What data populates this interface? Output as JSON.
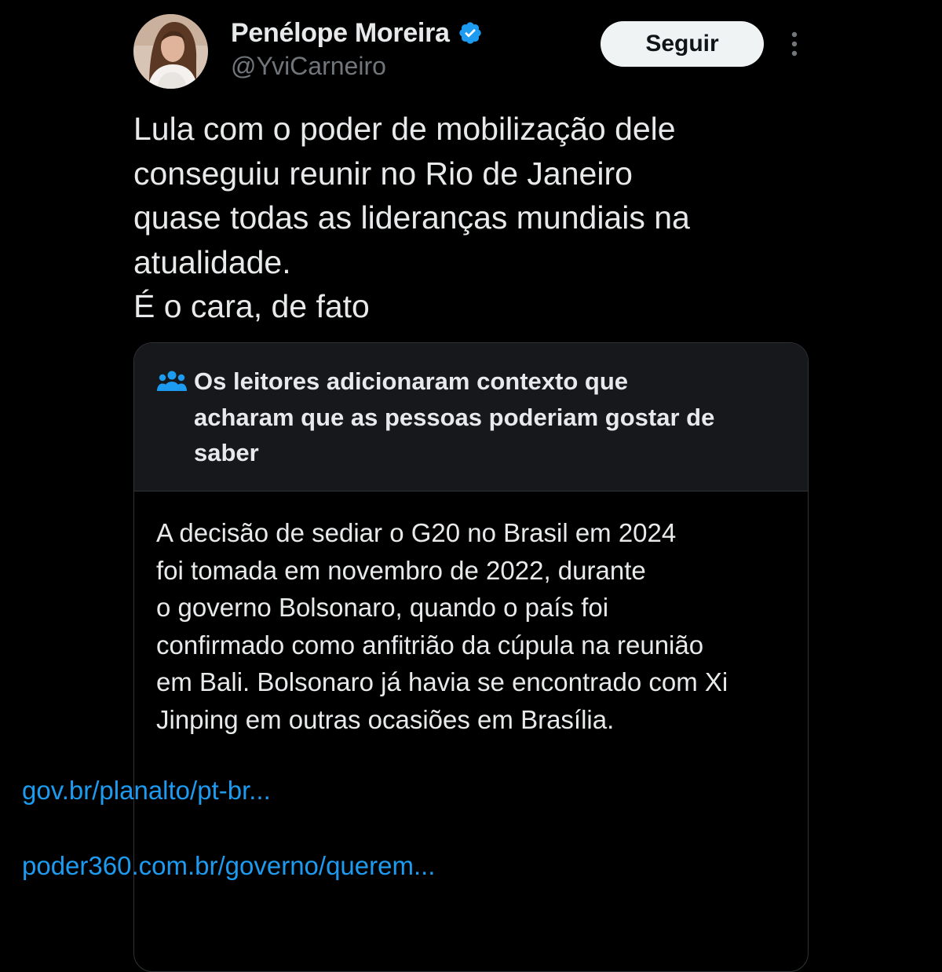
{
  "author": {
    "display_name": "Penélope Moreira",
    "handle": "@YviCarneiro",
    "verified": true
  },
  "actions": {
    "follow_label": "Seguir",
    "more_icon": "more-vertical-icon"
  },
  "tweet": {
    "lines": [
      "Lula com o poder de mobilização dele",
      "conseguiu reunir no Rio de Janeiro",
      "quase todas as lideranças mundiais na",
      "atualidade.",
      "É o cara, de fato"
    ]
  },
  "community_note": {
    "icon": "people-icon",
    "title_lines": [
      "Os leitores adicionaram contexto que",
      "acharam que as pessoas poderiam gostar de",
      "saber"
    ],
    "body_lines": [
      "A decisão de sediar o G20 no Brasil em 2024",
      "foi tomada em novembro de 2022, durante",
      "o governo Bolsonaro, quando o país foi",
      "confirmado como anfitrião da cúpula na reunião",
      "em Bali. Bolsonaro já havia se encontrado com Xi",
      "Jinping em outras ocasiões em Brasília."
    ],
    "links": [
      "gov.br/planalto/pt-br...",
      "poder360.com.br/governo/querem..."
    ]
  },
  "colors": {
    "background": "#000000",
    "text_primary": "#e7e9ea",
    "text_secondary": "#71767b",
    "link": "#1d9bf0",
    "verified_badge": "#1d9bf0",
    "note_header_bg": "#16181c",
    "border": "#2f3336",
    "follow_button_bg": "#eff3f4"
  }
}
